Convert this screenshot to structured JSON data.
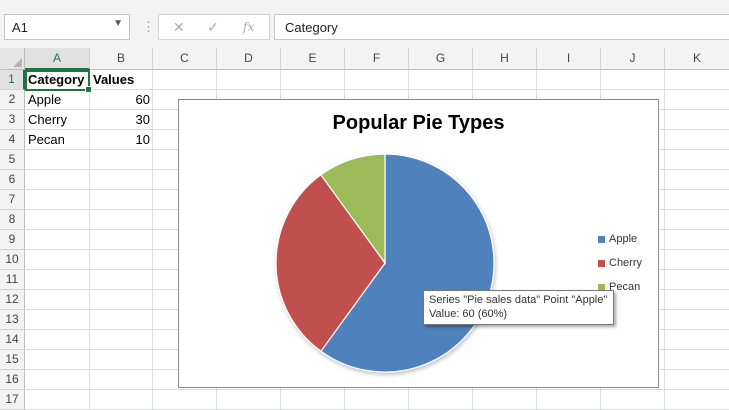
{
  "formula_bar": {
    "name_box": "A1",
    "cancel_glyph": "✕",
    "enter_glyph": "✓",
    "fx_glyph": "fx",
    "content": "Category"
  },
  "columns": [
    "A",
    "B",
    "C",
    "D",
    "E",
    "F",
    "G",
    "H",
    "I",
    "J",
    "K"
  ],
  "rows": [
    "1",
    "2",
    "3",
    "4",
    "5",
    "6",
    "7",
    "8",
    "9",
    "10",
    "11",
    "12",
    "13",
    "14",
    "15",
    "16",
    "17"
  ],
  "sheet": {
    "header": {
      "category": "Category",
      "values": "Values"
    },
    "data": [
      {
        "category": "Apple",
        "value": "60"
      },
      {
        "category": "Cherry",
        "value": "30"
      },
      {
        "category": "Pecan",
        "value": "10"
      }
    ]
  },
  "chart_data": {
    "type": "pie",
    "title": "Popular Pie Types",
    "categories": [
      "Apple",
      "Cherry",
      "Pecan"
    ],
    "values": [
      60,
      30,
      10
    ],
    "colors": [
      "#4f81bd",
      "#c0504d",
      "#9bbb59"
    ],
    "legend_position": "right",
    "series": [
      {
        "name": "Pie sales data",
        "values": [
          60,
          30,
          10
        ]
      }
    ]
  },
  "tooltip": {
    "line1": "Series \"Pie sales data\" Point \"Apple\"",
    "line2": "Value: 60 (60%)"
  }
}
